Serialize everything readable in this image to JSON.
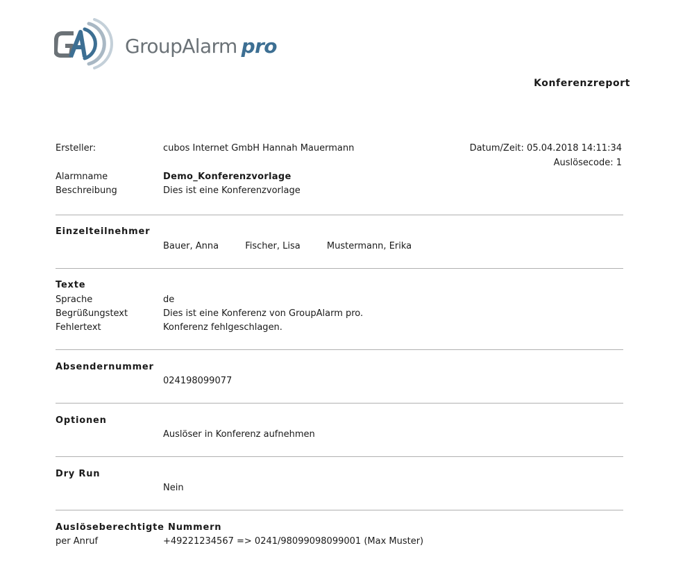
{
  "brand": {
    "logo_mark": "GA",
    "name": "GroupAlarm",
    "suffix": "pro",
    "colors": {
      "gray": "#6b7277",
      "blue": "#3d6f93",
      "arc": "#a9b8c4"
    }
  },
  "report_title": "Konferenzreport",
  "header": {
    "creator_label": "Ersteller:",
    "creator_value": "cubos Internet GmbH Hannah Mauermann",
    "datetime": "Datum/Zeit: 05.04.2018 14:11:34",
    "trigger_code": "Auslösecode: 1",
    "alarm_name_label": "Alarmname",
    "alarm_name_value": "Demo_Konferenzvorlage",
    "description_label": "Beschreibung",
    "description_value": "Dies ist eine Konferenzvorlage"
  },
  "participants": {
    "heading": "Einzelteilnehmer",
    "names": [
      "Bauer, Anna",
      "Fischer, Lisa",
      "Mustermann, Erika"
    ]
  },
  "texts": {
    "heading": "Texte",
    "language_label": "Sprache",
    "language_value": "de",
    "greeting_label": "Begrüßungstext",
    "greeting_value": "Dies ist eine Konferenz von GroupAlarm pro.",
    "error_label": "Fehlertext",
    "error_value": "Konferenz fehlgeschlagen."
  },
  "sender": {
    "heading": "Absendernummer",
    "value": "024198099077"
  },
  "options": {
    "heading": "Optionen",
    "value": "Auslöser in Konferenz aufnehmen"
  },
  "dry_run": {
    "heading": "Dry Run",
    "value": "Nein"
  },
  "authorized_numbers": {
    "heading": "Auslöseberechtigte Nummern",
    "per_call_label": "per Anruf",
    "per_call_value": "+49221234567 => 0241/98099098099001 (Max Muster)"
  }
}
